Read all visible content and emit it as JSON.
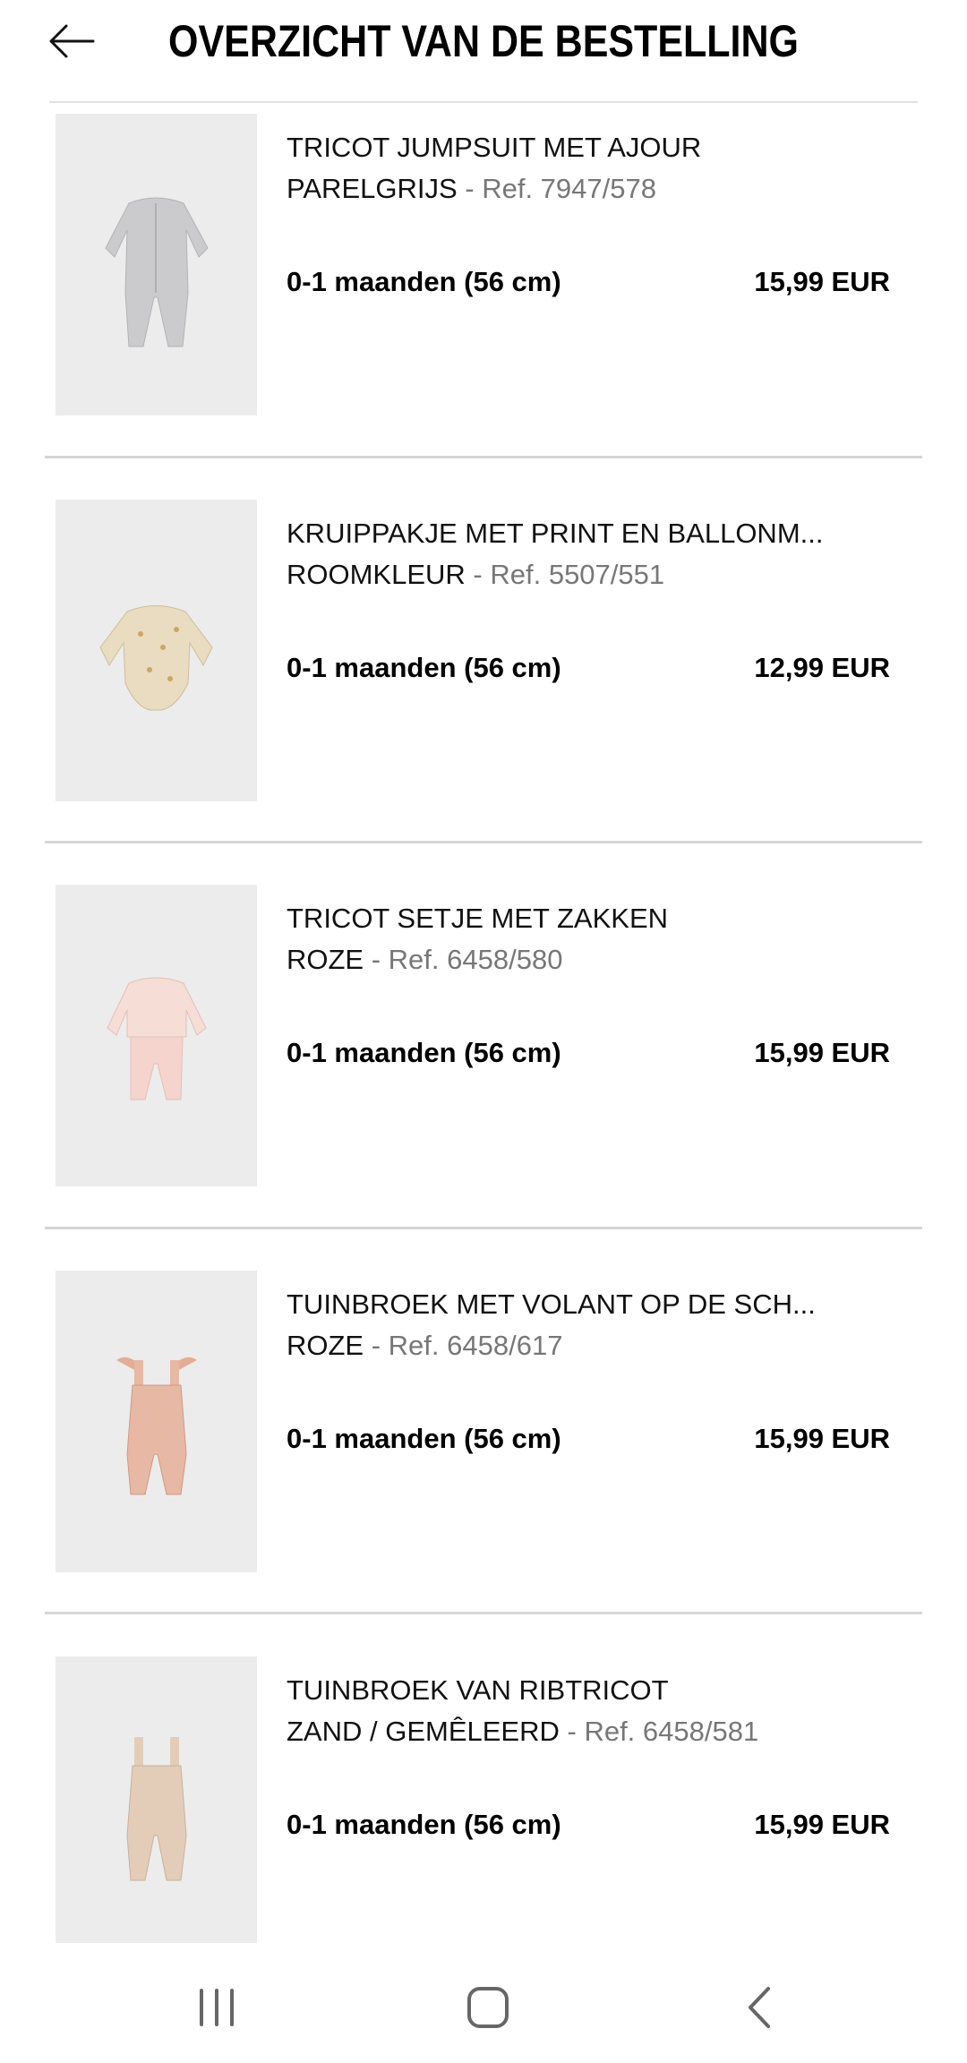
{
  "header": {
    "title": "OVERZICHT VAN DE BESTELLING",
    "back_icon": "arrow-left-icon"
  },
  "items": [
    {
      "name": "TRICOT JUMPSUIT MET AJOUR",
      "color": "PARELGRIJS",
      "ref": " - Ref. 7947/578",
      "size": "0-1 maanden (56 cm)",
      "price": "15,99 EUR",
      "garment_color": "#c9c9cb"
    },
    {
      "name": "KRUIPPAKJE MET PRINT EN BALLONM...",
      "color": "ROOMKLEUR",
      "ref": " - Ref. 5507/551",
      "size": "0-1 maanden (56 cm)",
      "price": "12,99 EUR",
      "garment_color": "#e9dcc0"
    },
    {
      "name": "TRICOT SETJE MET ZAKKEN",
      "color": "ROZE",
      "ref": " - Ref. 6458/580",
      "size": "0-1 maanden (56 cm)",
      "price": "15,99 EUR",
      "garment_color": "#f4d9d3"
    },
    {
      "name": "TUINBROEK MET VOLANT OP DE SCH...",
      "color": "ROZE",
      "ref": " - Ref. 6458/617",
      "size": "0-1 maanden (56 cm)",
      "price": "15,99 EUR",
      "garment_color": "#e7b8a4"
    },
    {
      "name": "TUINBROEK VAN RIBTRICOT",
      "color": "ZAND / GEMÊLEERD",
      "ref": " - Ref. 6458/581",
      "size": "0-1 maanden (56 cm)",
      "price": "15,99 EUR",
      "garment_color": "#e3cdb9"
    }
  ],
  "navbar": {
    "recents_icon": "recent-apps-icon",
    "home_icon": "home-icon",
    "back_icon": "nav-back-icon"
  }
}
